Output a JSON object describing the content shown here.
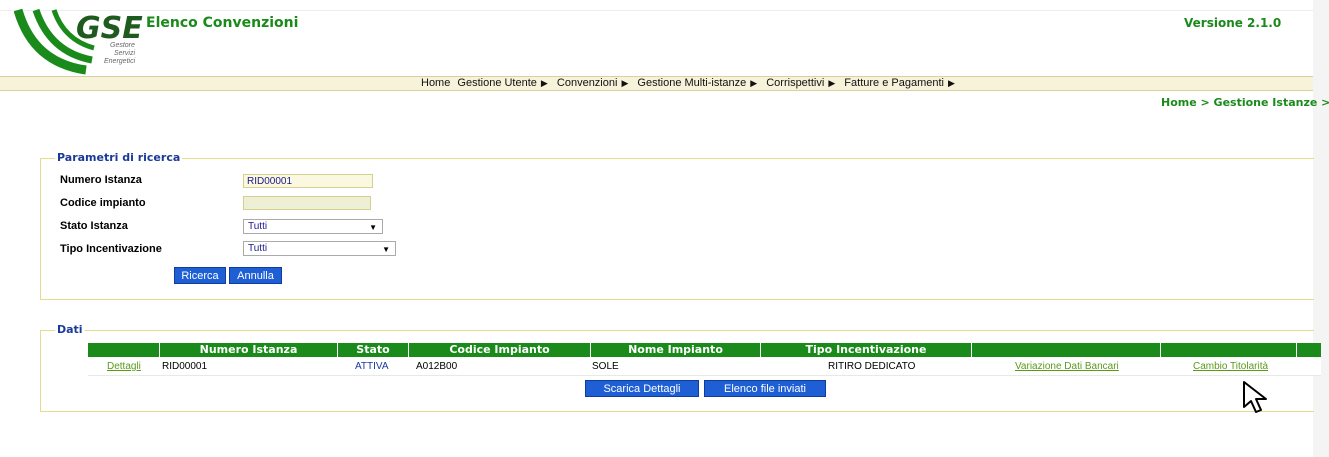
{
  "header": {
    "logo_text": "GSE",
    "logo_sub": [
      "Gestore",
      "Servizi",
      "Energetici"
    ],
    "app_title": "Elenco Convenzioni",
    "version": "Versione 2.1.0"
  },
  "menu": {
    "items": [
      "Home",
      "Gestione Utente",
      "Convenzioni",
      "Gestione Multi-istanze",
      "Corrispettivi",
      "Fatture e Pagamenti"
    ]
  },
  "breadcrumb": "Home > Gestione Istanze > Istanz",
  "search": {
    "legend": "Parametri di ricerca",
    "numero_istanza_label": "Numero Istanza",
    "numero_istanza_value": "RID00001",
    "codice_impianto_label": "Codice impianto",
    "codice_impianto_value": "",
    "stato_istanza_label": "Stato Istanza",
    "stato_istanza_value": "Tutti",
    "tipo_incentivazione_label": "Tipo Incentivazione",
    "tipo_incentivazione_value": "Tutti",
    "search_button": "Ricerca",
    "cancel_button": "Annulla"
  },
  "data": {
    "legend": "Dati",
    "columns": [
      "",
      "Numero Istanza",
      "Stato",
      "Codice Impianto",
      "Nome Impianto",
      "Tipo Incentivazione",
      "",
      "",
      ""
    ],
    "row": {
      "details_link": "Dettagli",
      "numero_istanza": "RID00001",
      "stato": "ATTIVA",
      "codice_impianto": "A012B00",
      "nome_impianto": "SOLE",
      "tipo_incentivazione": "RITIRO DEDICATO",
      "variazione_link": "Variazione Dati Bancari",
      "cambio_link": "Cambio Titolarità"
    },
    "download_button": "Scarica Dettagli",
    "files_button": "Elenco file inviati"
  },
  "colors": {
    "accent_green": "#1a8a1a",
    "button_blue": "#1e5fd6",
    "legend_blue": "#1a3a9a",
    "fieldset_border": "#e3dc8a"
  }
}
